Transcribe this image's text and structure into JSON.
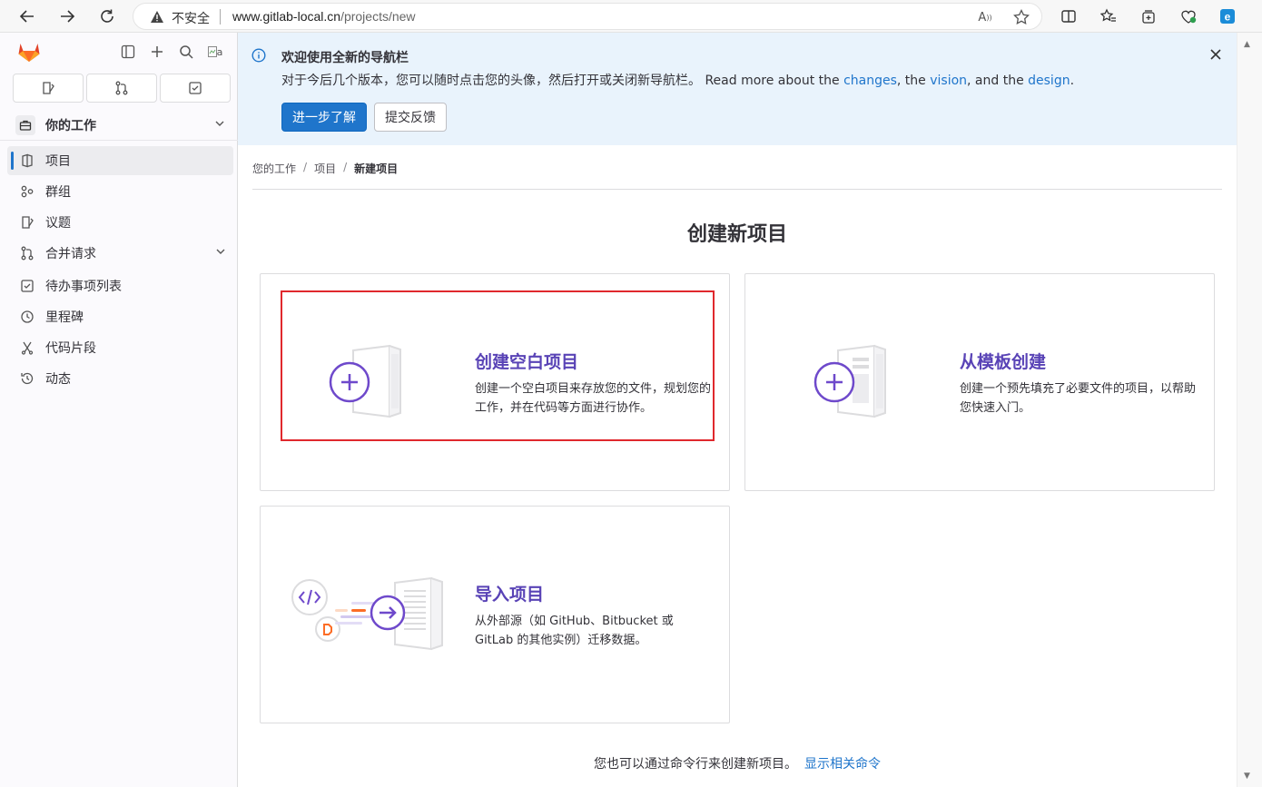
{
  "browser": {
    "security_label": "不安全",
    "url_host": "www.gitlab-local.cn",
    "url_path": "/projects/new"
  },
  "sidebar": {
    "context_label": "你的工作",
    "items": [
      {
        "label": "项目",
        "icon": "project-icon",
        "active": true
      },
      {
        "label": "群组",
        "icon": "group-icon"
      },
      {
        "label": "议题",
        "icon": "issues-icon"
      },
      {
        "label": "合并请求",
        "icon": "merge-request-icon",
        "has_chevron": true
      },
      {
        "label": "待办事项列表",
        "icon": "todo-icon"
      },
      {
        "label": "里程碑",
        "icon": "milestone-icon"
      },
      {
        "label": "代码片段",
        "icon": "snippet-icon"
      },
      {
        "label": "动态",
        "icon": "history-icon"
      }
    ],
    "avatar_alt": "a"
  },
  "banner": {
    "title": "欢迎使用全新的导航栏",
    "body_text": "对于今后几个版本，您可以随时点击您的头像，然后打开或关闭新导航栏。 Read more about the ",
    "link_changes": "changes",
    "text_the": ", the ",
    "link_vision": "vision",
    "text_and": ", and the ",
    "link_design": "design",
    "text_end": ".",
    "primary_button": "进一步了解",
    "secondary_button": "提交反馈"
  },
  "breadcrumb": {
    "items": [
      "您的工作",
      "项目"
    ],
    "current": "新建项目"
  },
  "page": {
    "title": "创建新项目",
    "cards": [
      {
        "title": "创建空白项目",
        "description": "创建一个空白项目来存放您的文件，规划您的工作，并在代码等方面进行协作。"
      },
      {
        "title": "从模板创建",
        "description": "创建一个预先填充了必要文件的项目，以帮助您快速入门。"
      },
      {
        "title": "导入项目",
        "description": "从外部源（如 GitHub、Bitbucket 或 GitLab 的其他实例）迁移数据。"
      }
    ],
    "footer_text": "您也可以通过命令行来创建新项目。",
    "footer_link": "显示相关命令"
  },
  "colors": {
    "accent": "#1f75cb",
    "card_title": "#5943b6",
    "highlight": "#e0282d",
    "banner_bg": "#e9f3fc"
  }
}
